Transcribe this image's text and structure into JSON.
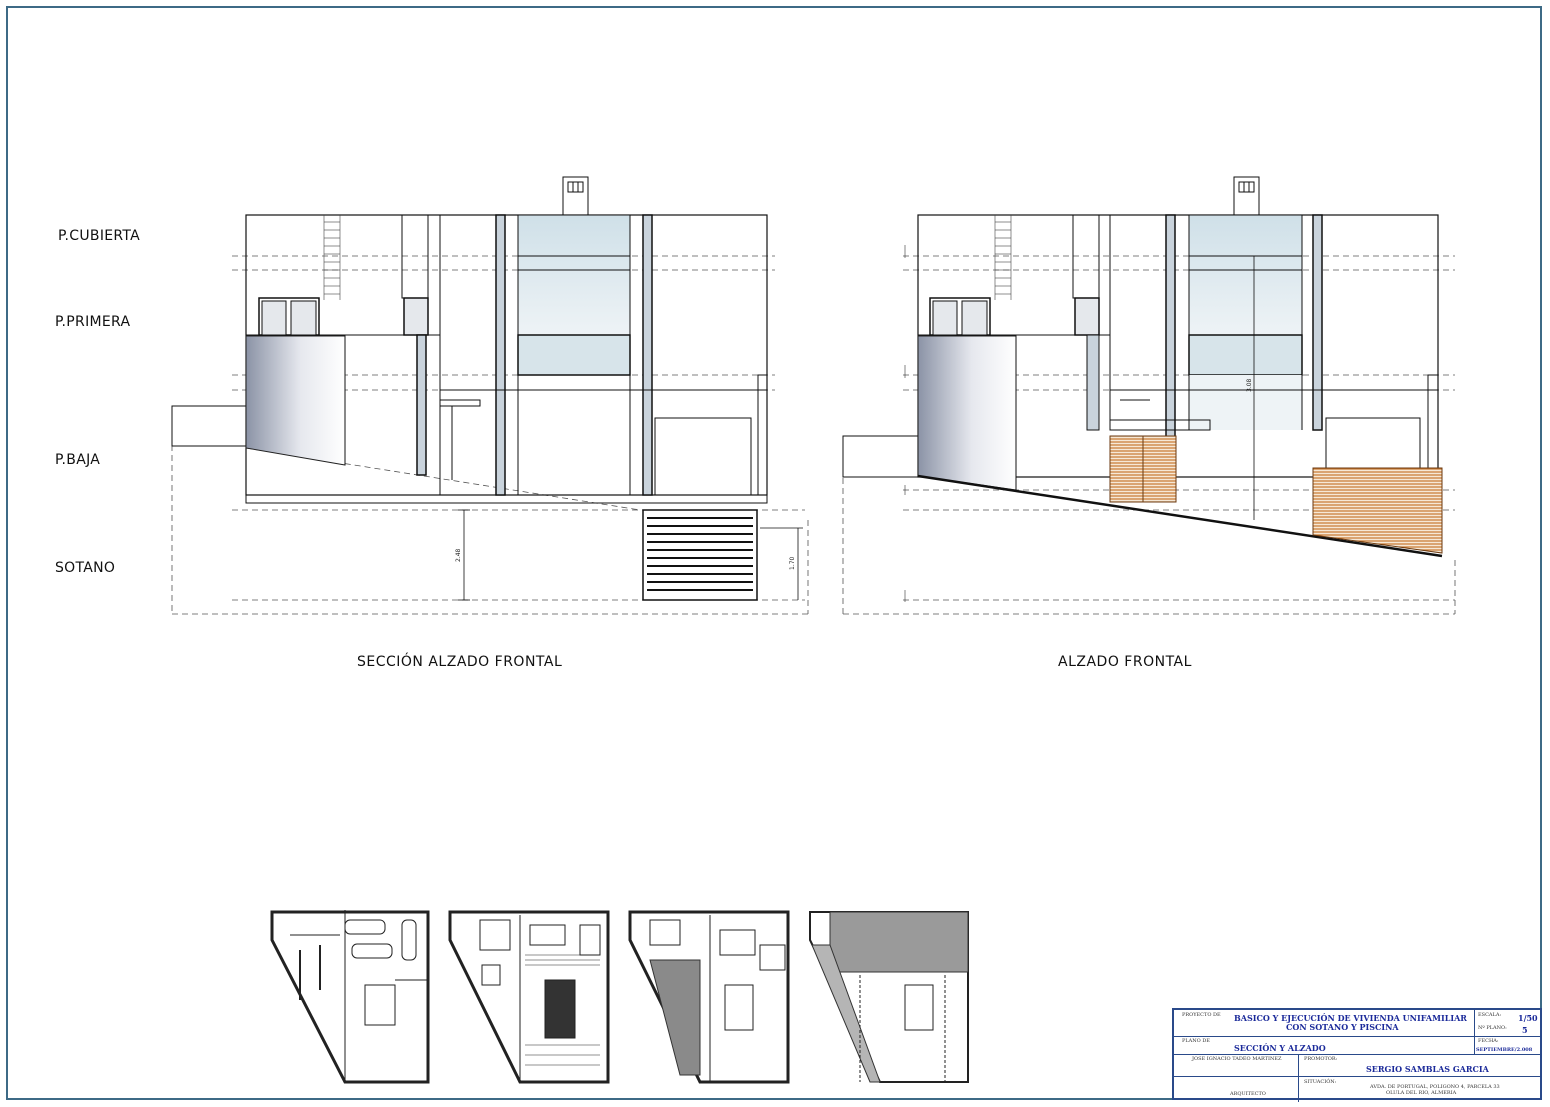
{
  "levels": {
    "cubierta": "P.CUBIERTA",
    "primera": "P.PRIMERA",
    "baja": "P.BAJA",
    "sotano": "SOTANO"
  },
  "captions": {
    "left": "SECCIÓN ALZADO FRONTAL",
    "right": "ALZADO FRONTAL"
  },
  "dimensions": {
    "d1": "2.48",
    "d2": "1.70",
    "d3": "3.08"
  },
  "title_block": {
    "proyecto_label": "PROYECTO DE",
    "proyecto_line1": "BASICO Y EJECUCIÓN DE VIVIENDA UNIFAMILIAR",
    "proyecto_line2": "CON SOTANO Y PISCINA",
    "escala_label": "ESCALA:",
    "escala": "1/50",
    "plano_num_label": "Nº PLANO:",
    "plano_num": "5",
    "plano_label": "PLANO DE",
    "plano": "SECCIÓN Y ALZADO",
    "fecha_label": "FECHA:",
    "fecha": "SEPTIEMBRE/2.008",
    "autor": "JOSE IGNACIO TADEO MARTINEZ",
    "autor_role": "ARQUITECTO",
    "promotor_label": "PROMOTOR:",
    "promotor": "SERGIO SAMBLAS GARCIA",
    "situacion_label": "SITUACIÓN:",
    "situacion_line1": "AVDA. DE PORTUGAL, POLIGONO 4, PARCELA 33",
    "situacion_line2": "OLULA DEL RIO, ALMERIA"
  },
  "colors": {
    "frame": "#3d6a86",
    "glass": "#dde8ee",
    "wood": "#c8772e",
    "title_ink": "#1b2a9a"
  }
}
